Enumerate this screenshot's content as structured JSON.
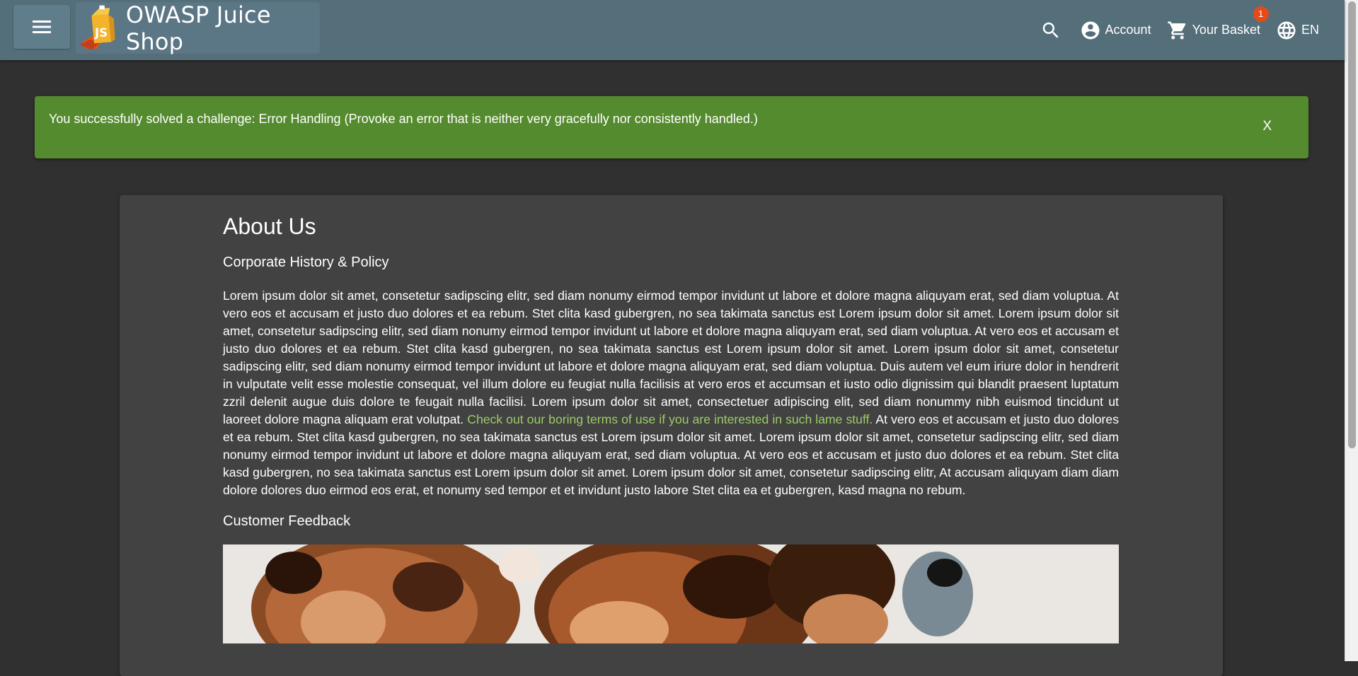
{
  "header": {
    "title": "OWASP Juice Shop",
    "account_label": "Account",
    "basket_label": "Your Basket",
    "basket_count": "1",
    "language_label": "EN"
  },
  "notification": {
    "message": "You successfully solved a challenge: Error Handling (Provoke an error that is neither very gracefully nor consistently handled.)",
    "close_label": "X"
  },
  "about": {
    "title": "About Us",
    "section_title": "Corporate History & Policy",
    "paragraph_before_link": "Lorem ipsum dolor sit amet, consetetur sadipscing elitr, sed diam nonumy eirmod tempor invidunt ut labore et dolore magna aliquyam erat, sed diam voluptua. At vero eos et accusam et justo duo dolores et ea rebum. Stet clita kasd gubergren, no sea takimata sanctus est Lorem ipsum dolor sit amet. Lorem ipsum dolor sit amet, consetetur sadipscing elitr, sed diam nonumy eirmod tempor invidunt ut labore et dolore magna aliquyam erat, sed diam voluptua. At vero eos et accusam et justo duo dolores et ea rebum. Stet clita kasd gubergren, no sea takimata sanctus est Lorem ipsum dolor sit amet. Lorem ipsum dolor sit amet, consetetur sadipscing elitr, sed diam nonumy eirmod tempor invidunt ut labore et dolore magna aliquyam erat, sed diam voluptua. Duis autem vel eum iriure dolor in hendrerit in vulputate velit esse molestie consequat, vel illum dolore eu feugiat nulla facilisis at vero eros et accumsan et iusto odio dignissim qui blandit praesent luptatum zzril delenit augue duis dolore te feugait nulla facilisi. Lorem ipsum dolor sit amet, consectetuer adipiscing elit, sed diam nonummy nibh euismod tincidunt ut laoreet dolore magna aliquam erat volutpat.",
    "link_text": "Check out our boring terms of use if you are interested in such lame stuff.",
    "paragraph_after_link": "At vero eos et accusam et justo duo dolores et ea rebum. Stet clita kasd gubergren, no sea takimata sanctus est Lorem ipsum dolor sit amet. Lorem ipsum dolor sit amet, consetetur sadipscing elitr, sed diam nonumy eirmod tempor invidunt ut labore et dolore magna aliquyam erat, sed diam voluptua. At vero eos et accusam et justo duo dolores et ea rebum. Stet clita kasd gubergren, no sea takimata sanctus est Lorem ipsum dolor sit amet. Lorem ipsum dolor sit amet, consetetur sadipscing elitr, At accusam aliquyam diam diam dolore dolores duo eirmod eos erat, et nonumy sed tempor et et invidunt justo labore Stet clita ea et gubergren, kasd magna no rebum.",
    "feedback_title": "Customer Feedback"
  },
  "colors": {
    "toolbar": "#546e7a",
    "background": "#303030",
    "card": "#424242",
    "success": "#558b2f",
    "link": "#9ccc65",
    "badge": "#e64a19"
  },
  "icons": [
    "menu-icon",
    "juice-shop-logo",
    "search-icon",
    "account-circle-icon",
    "shopping-cart-icon",
    "language-icon"
  ]
}
